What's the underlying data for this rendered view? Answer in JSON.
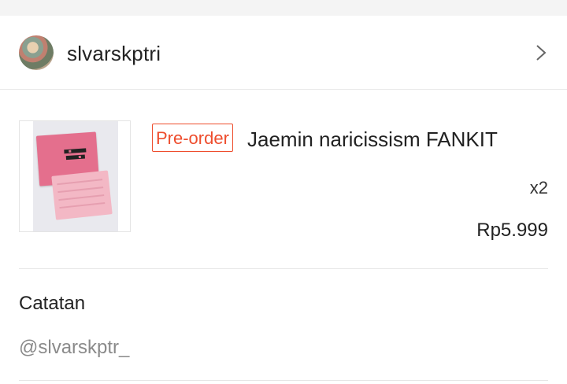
{
  "shop": {
    "name": "slvarskptri",
    "avatar_icon": "shop-avatar",
    "chevron_icon": "chevron-right-icon"
  },
  "product": {
    "badge": "Pre-order",
    "title": "Jaemin naricissism FANKIT",
    "quantity": "x2",
    "price": "Rp5.999",
    "thumbnail_text": "NARC ISSISM",
    "badge_color": "#ee4d2d"
  },
  "note": {
    "label": "Catatan",
    "value": "@slvarskptr_"
  }
}
